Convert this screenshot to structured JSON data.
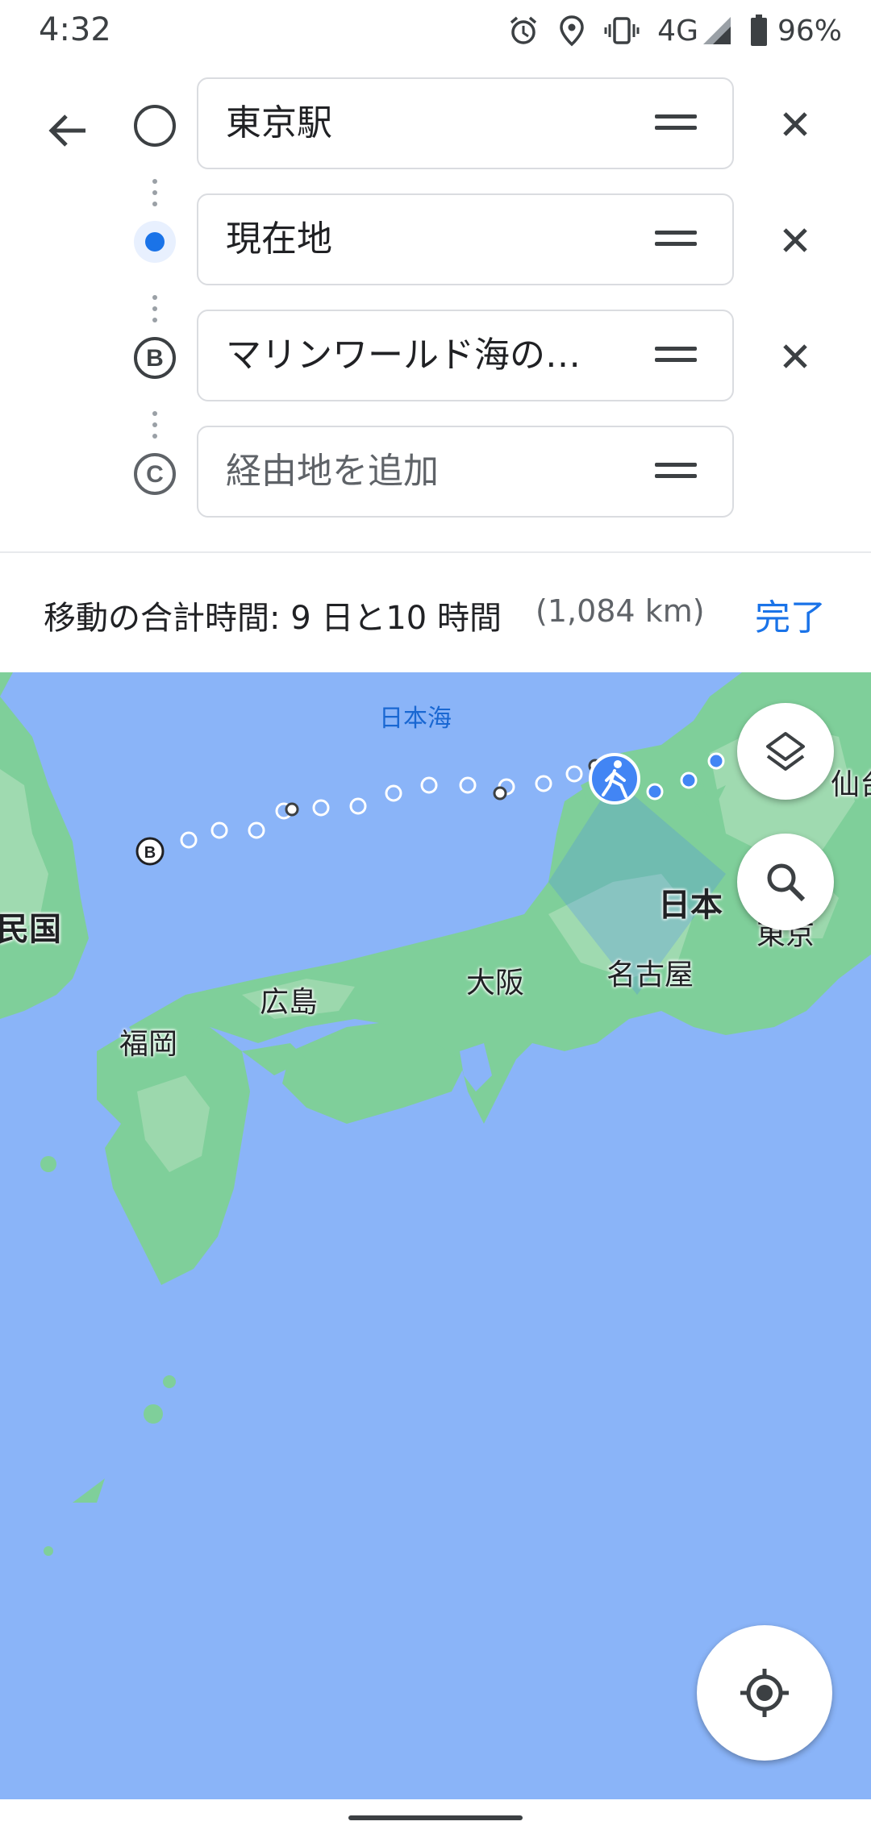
{
  "status_bar": {
    "time": "4:32",
    "network": "4G",
    "battery": "96%",
    "icons": [
      "alarm-icon",
      "location-icon",
      "vibrate-icon",
      "signal-icon",
      "battery-icon"
    ]
  },
  "directions": {
    "stops": [
      {
        "marker": "empty-circle",
        "value": "東京駅"
      },
      {
        "marker": "current-location-dot",
        "value": "現在地"
      },
      {
        "marker": "B",
        "value": "マリンワールド海の…"
      },
      {
        "marker": "C",
        "placeholder": "経由地を追加"
      }
    ]
  },
  "summary": {
    "text": "移動の合計時間: 9 日と10 時間",
    "distance": "(1,084 km)",
    "done_label": "完了"
  },
  "map": {
    "labels": {
      "sea": "日本海",
      "sendai": "仙台",
      "japan": "日本",
      "korea": "民国",
      "tokyo": "東京",
      "osaka": "大阪",
      "nagoya": "名古屋",
      "hiroshima": "広島",
      "fukuoka": "福岡"
    },
    "route_marker": "B",
    "colors": {
      "water": "#8ab4f8",
      "land": "#7fcf9a",
      "route": "#4285f4"
    }
  }
}
